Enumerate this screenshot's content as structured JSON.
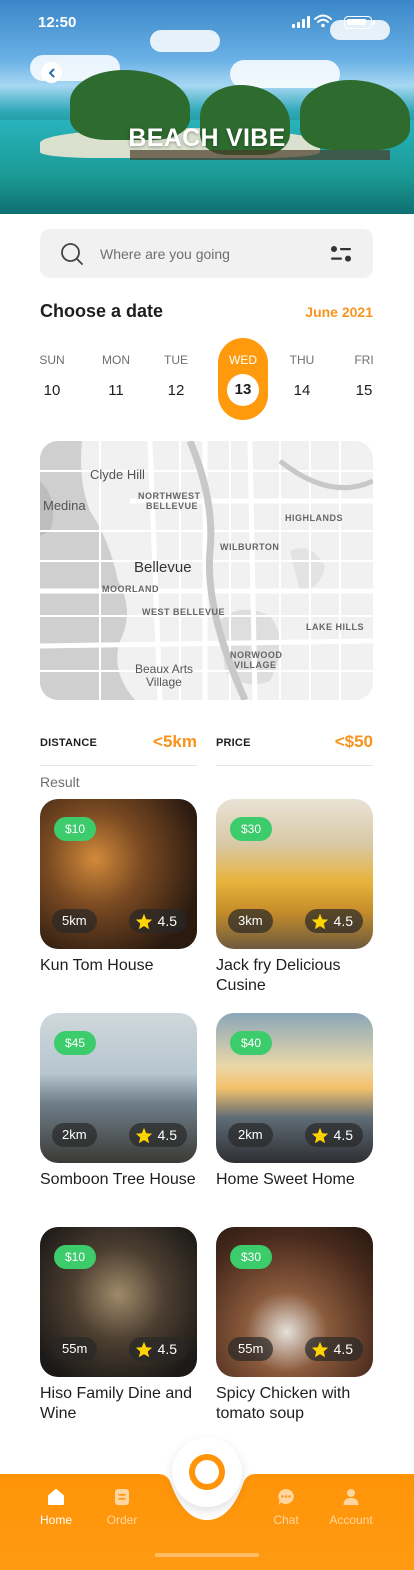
{
  "status_bar": {
    "time": "12:50"
  },
  "hero": {
    "title": "BEACH VIBE"
  },
  "search": {
    "placeholder": "Where are you going"
  },
  "date_section": {
    "title": "Choose a date",
    "month": "June 2021",
    "days": [
      {
        "name": "SUN",
        "num": "10"
      },
      {
        "name": "MON",
        "num": "11"
      },
      {
        "name": "TUE",
        "num": "12"
      },
      {
        "name": "WED",
        "num": "13"
      },
      {
        "name": "THU",
        "num": "14"
      },
      {
        "name": "FRI",
        "num": "15"
      }
    ],
    "selected_index": 3
  },
  "map": {
    "labels": [
      "Clyde Hill",
      "Medina",
      "NORTHWEST",
      "BELLEVUE",
      "HIGHLANDS",
      "WILBURTON",
      "Bellevue",
      "MOORLAND",
      "WEST BELLEVUE",
      "LAKE HILLS",
      "NORWOOD",
      "VILLAGE",
      "Beaux Arts",
      "Village"
    ]
  },
  "filters": {
    "distance": {
      "label": "DISTANCE",
      "value": "<5km"
    },
    "price": {
      "label": "PRICE",
      "value": "<$50"
    }
  },
  "result_label": "Result",
  "results": [
    {
      "name": "Kun Tom House",
      "price": "$10",
      "distance": "5km",
      "rating": "4.5"
    },
    {
      "name": "Jack fry Delicious Cusine",
      "price": "$30",
      "distance": "3km",
      "rating": "4.5"
    },
    {
      "name": "Somboon Tree House",
      "price": "$45",
      "distance": "2km",
      "rating": "4.5"
    },
    {
      "name": "Home Sweet Home",
      "price": "$40",
      "distance": "2km",
      "rating": "4.5"
    },
    {
      "name": "Hiso Family Dine and Wine",
      "price": "$10",
      "distance": "55m",
      "rating": "4.5"
    },
    {
      "name": "Spicy Chicken with tomato soup",
      "price": "$30",
      "distance": "55m",
      "rating": "4.5"
    }
  ],
  "nav": {
    "items": [
      {
        "label": "Home",
        "icon": "home-icon",
        "active": true
      },
      {
        "label": "Order",
        "icon": "order-icon",
        "active": false
      },
      {
        "label": "Chat",
        "icon": "chat-icon",
        "active": false
      },
      {
        "label": "Account",
        "icon": "account-icon",
        "active": false
      }
    ],
    "center_icon": "ring-icon"
  },
  "colors": {
    "accent": "#ff9a0d",
    "accent_text": "#f7941d",
    "price_badge": "#3ccc6b",
    "nav_bg": "#ff9408"
  }
}
